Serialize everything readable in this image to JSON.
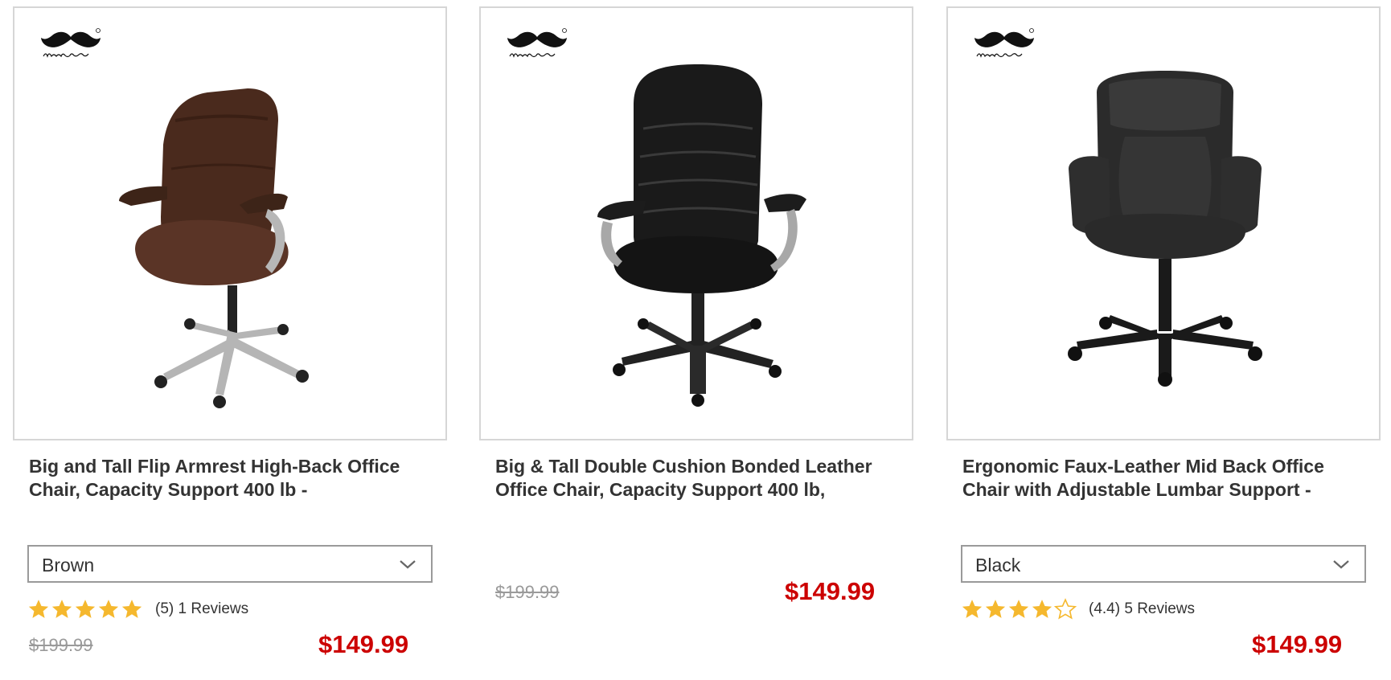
{
  "colors": {
    "price": "#cc0000",
    "old_price": "#9a9a9a",
    "star": "#f5b82e",
    "border": "#d6d6d6"
  },
  "products": [
    {
      "image_icon": "brown-office-chair",
      "title_line1": "Big and Tall Flip Armrest High-Back Office",
      "title_line2": "Chair, Capacity Support 400 lb -",
      "selected_color": "Brown",
      "rating_value": 5,
      "rating_label": "(5) 1 Reviews",
      "old_price": "$199.99",
      "price": "$149.99"
    },
    {
      "image_icon": "black-office-chair",
      "title_line1": "Big & Tall Double Cushion Bonded Leather",
      "title_line2": "Office Chair, Capacity Support 400 lb,",
      "old_price": "$199.99",
      "price": "$149.99"
    },
    {
      "image_icon": "black-mid-back-office-chair",
      "title_line1": "Ergonomic Faux-Leather Mid Back Office",
      "title_line2": "Chair with Adjustable Lumbar Support -",
      "selected_color": "Black",
      "rating_value": 4.4,
      "rating_label": "(4.4) 5 Reviews",
      "price": "$149.99"
    }
  ]
}
